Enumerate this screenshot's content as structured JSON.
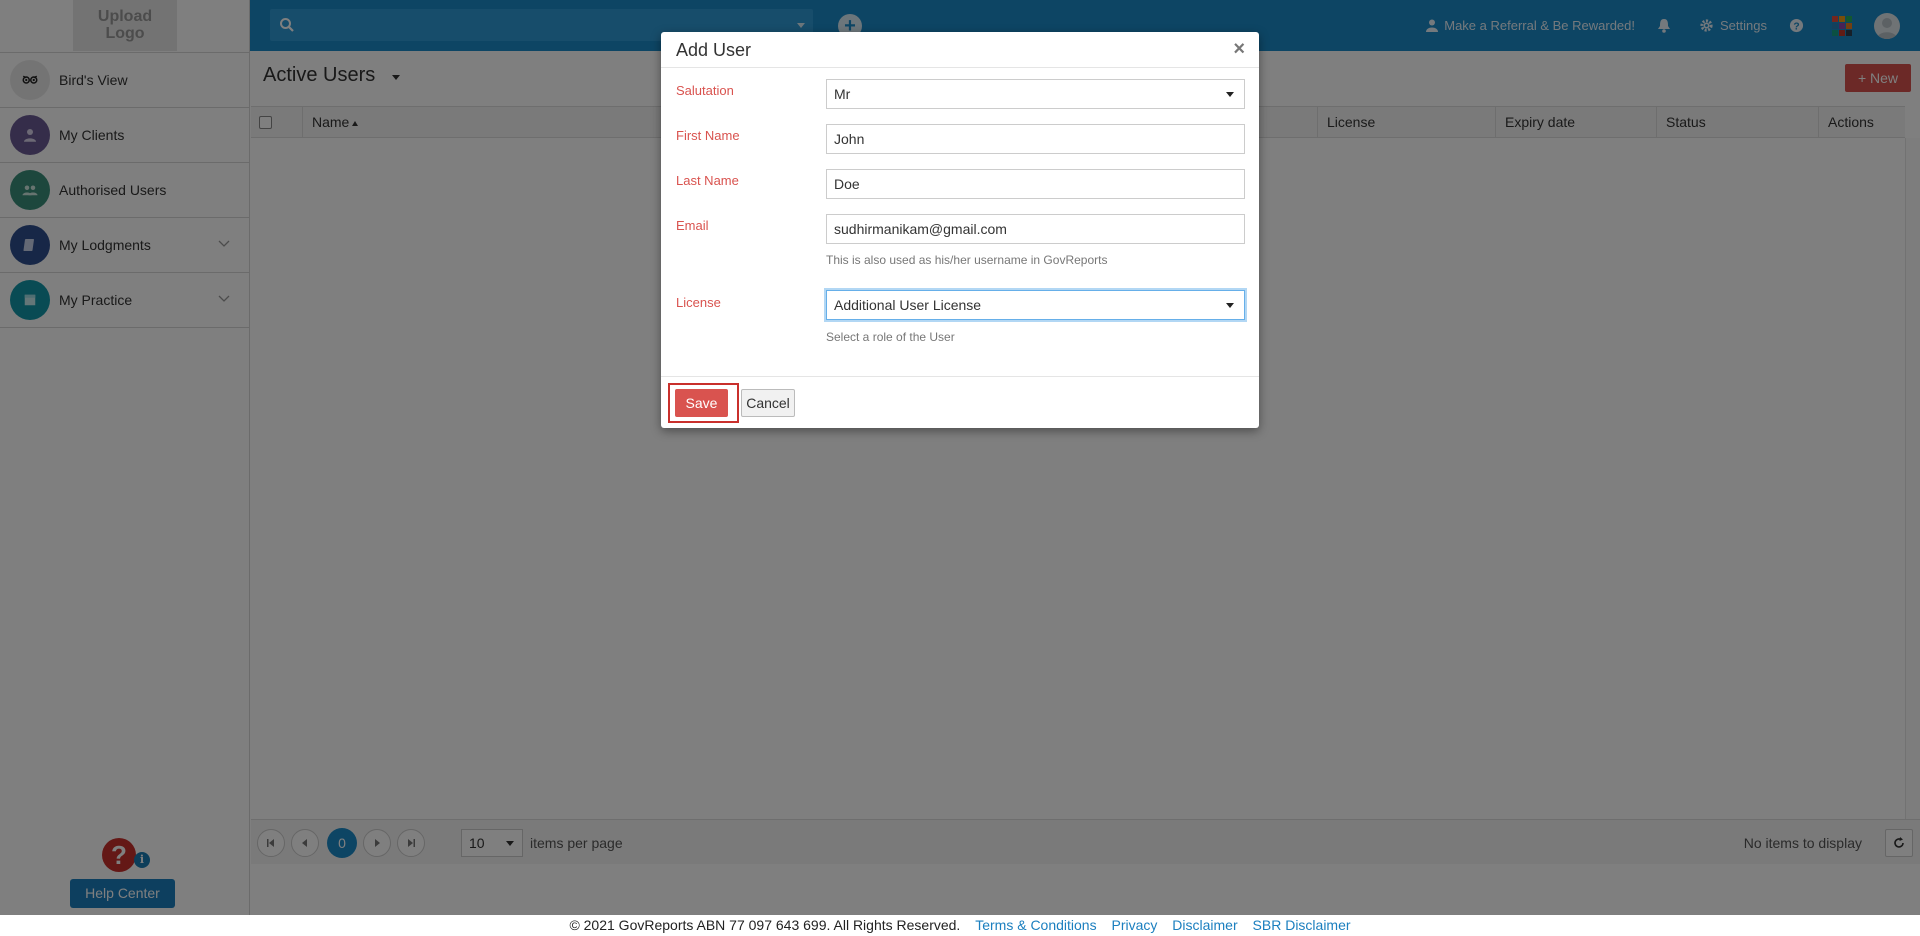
{
  "sidebar": {
    "logo_text": "Upload Logo",
    "items": [
      {
        "label": "Bird's View",
        "icon": "owl-icon",
        "color": "#8a8a8a"
      },
      {
        "label": "My Clients",
        "icon": "user-icon",
        "color": "#6b5b95"
      },
      {
        "label": "Authorised Users",
        "icon": "users-icon",
        "color": "#3a8f7a"
      },
      {
        "label": "My Lodgments",
        "icon": "book-icon",
        "color": "#2f4f8f"
      },
      {
        "label": "My Practice",
        "icon": "briefcase-icon",
        "color": "#1297a8"
      }
    ],
    "help_badge": "?",
    "help_info": "i",
    "help_center": "Help Center"
  },
  "header": {
    "search_placeholder": "",
    "referral": "Make a Referral & Be Rewarded!",
    "settings": "Settings"
  },
  "main": {
    "title": "Active Users",
    "new_button": "New",
    "columns": [
      "Name",
      "License",
      "Expiry date",
      "Status",
      "Actions"
    ],
    "pager": {
      "current_page": "0",
      "per_page": "10",
      "per_page_label": "items per page",
      "no_items": "No items to display"
    }
  },
  "modal": {
    "title": "Add User",
    "close": "×",
    "fields": {
      "salutation": {
        "label": "Salutation",
        "value": "Mr"
      },
      "first_name": {
        "label": "First Name",
        "value": "John"
      },
      "last_name": {
        "label": "Last Name",
        "value": "Doe"
      },
      "email": {
        "label": "Email",
        "value": "sudhirmanikam@gmail.com",
        "help": "This is also used as his/her username in GovReports"
      },
      "license": {
        "label": "License",
        "value": "Additional User License",
        "help": "Select a role of the User"
      }
    },
    "save": "Save",
    "cancel": "Cancel"
  },
  "footer": {
    "copyright": "© 2021 GovReports ABN 77 097 643 699. All Rights Reserved.",
    "links": [
      "Terms & Conditions",
      "Privacy",
      "Disclaimer",
      "SBR Disclaimer"
    ]
  }
}
